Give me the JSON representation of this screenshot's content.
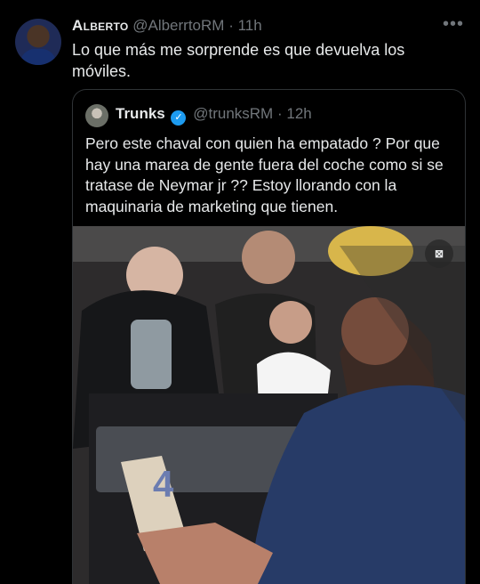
{
  "tweet": {
    "author_name": "Alberto",
    "handle": "@AlberrtoRM",
    "separator": "·",
    "time": "11h",
    "more_icon": "more-dots-icon",
    "text": "Lo que más me sorprende es que devuelva los móviles."
  },
  "quoted": {
    "author_name": "Trunks",
    "verified_icon": "verified-badge-icon",
    "handle": "@trunksRM",
    "separator": "·",
    "time": "12h",
    "text": "Pero este chaval con quien ha empatado ? Por que hay una marea de gente fuera del coche como si se tratase de Neymar jr ?? Estoy llorando con la maquinaria de marketing que tienen.",
    "phone_number": "4",
    "colors": {
      "verified": "#1d9bf0"
    }
  }
}
